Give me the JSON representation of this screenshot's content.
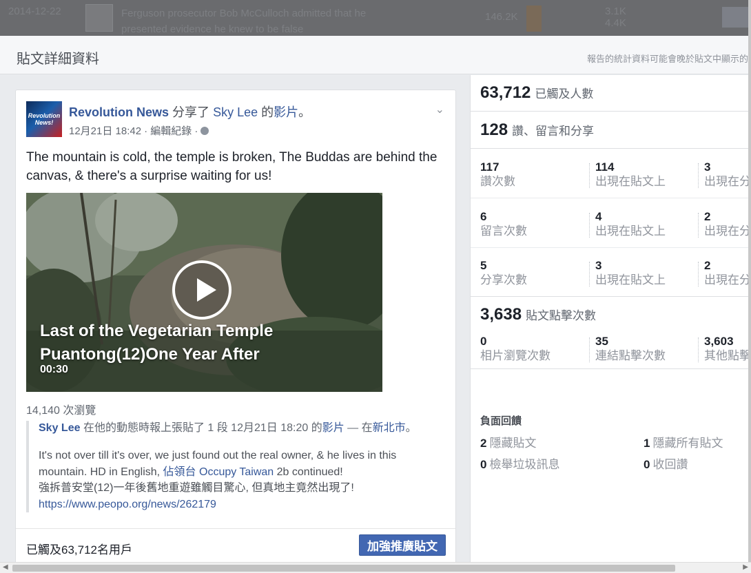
{
  "background_row": {
    "date": "2014-12-22",
    "text": "Ferguson prosecutor Bob McCulloch admitted that he presented evidence he knew to be false",
    "num1": "146.2K",
    "num2a": "3.1K",
    "num2b": "4.4K"
  },
  "dialog": {
    "title": "貼文詳細資料",
    "note": "報告的統計資料可能會晚於貼文中顯示的"
  },
  "post": {
    "page_name": "Revolution News",
    "avatar_text": "Revolution News!",
    "shared_word": "分享了",
    "shared_user": "Sky Lee",
    "possessive": "的",
    "shared_type": "影片",
    "end_mark": "。",
    "timestamp": "12月21日 18:42",
    "edit_history": "· 編輯紀錄 ·",
    "text": "The mountain is cold, the temple is broken, The Buddas are behind the canvas, & there's a surprise waiting for us!",
    "video": {
      "title": "Last of the Vegetarian Temple Puantong(12)One Year After",
      "duration": "00:30"
    },
    "views": "14,140 次瀏覽",
    "shared": {
      "author": "Sky Lee",
      "action": "在他的動態時報上張貼了 1 段 12月21日 18:20 的",
      "video_link": "影片",
      "dash": "— 在",
      "location": "新北市",
      "end_mark": "。",
      "body_1": "It's not over till it's over, we just found out the real owner, & he lives in this mountain. HD in English,",
      "body_link": "佔領台 Occupy Taiwan",
      "body_2": "2b continued!",
      "body_3": "強拆普安堂(12)一年後舊地重遊雖觸目驚心, 但真地主竟然出現了!",
      "url": "https://www.peopo.org/news/262179"
    },
    "footer": {
      "reach": "已觸及63,712名用戶",
      "boost": "加強推廣貼文"
    }
  },
  "stats": {
    "reach": {
      "num": "63,712",
      "label": "已觸及人數"
    },
    "engagement": {
      "num": "128",
      "label": "讚、留言和分享"
    },
    "likes": [
      {
        "num": "117",
        "label": "讚次數"
      },
      {
        "num": "114",
        "label": "出現在貼文上"
      },
      {
        "num": "3",
        "label": "出現在分享上"
      }
    ],
    "comments": [
      {
        "num": "6",
        "label": "留言次數"
      },
      {
        "num": "4",
        "label": "出現在貼文上"
      },
      {
        "num": "2",
        "label": "出現在分享上"
      }
    ],
    "shares": [
      {
        "num": "5",
        "label": "分享次數"
      },
      {
        "num": "3",
        "label": "出現在貼文上"
      },
      {
        "num": "2",
        "label": "出現在分享上"
      }
    ],
    "clicks": {
      "num": "3,638",
      "label": "貼文點擊次數"
    },
    "click_breakdown": [
      {
        "num": "0",
        "label": "相片瀏覽次數"
      },
      {
        "num": "35",
        "label": "連結點擊次數"
      },
      {
        "num": "3,603",
        "label": "其他點擊次數"
      }
    ],
    "negative": {
      "title": "負面回饋",
      "items": [
        {
          "num": "2",
          "label": "隱藏貼文"
        },
        {
          "num": "1",
          "label": "隱藏所有貼文"
        },
        {
          "num": "0",
          "label": "檢舉垃圾訊息"
        },
        {
          "num": "0",
          "label": "收回讚"
        }
      ]
    }
  },
  "colors": {
    "link": "#365899",
    "button": "#4267b2",
    "muted": "#90949c"
  },
  "icons": [
    "chevron-down-icon",
    "globe-icon",
    "play-icon"
  ]
}
